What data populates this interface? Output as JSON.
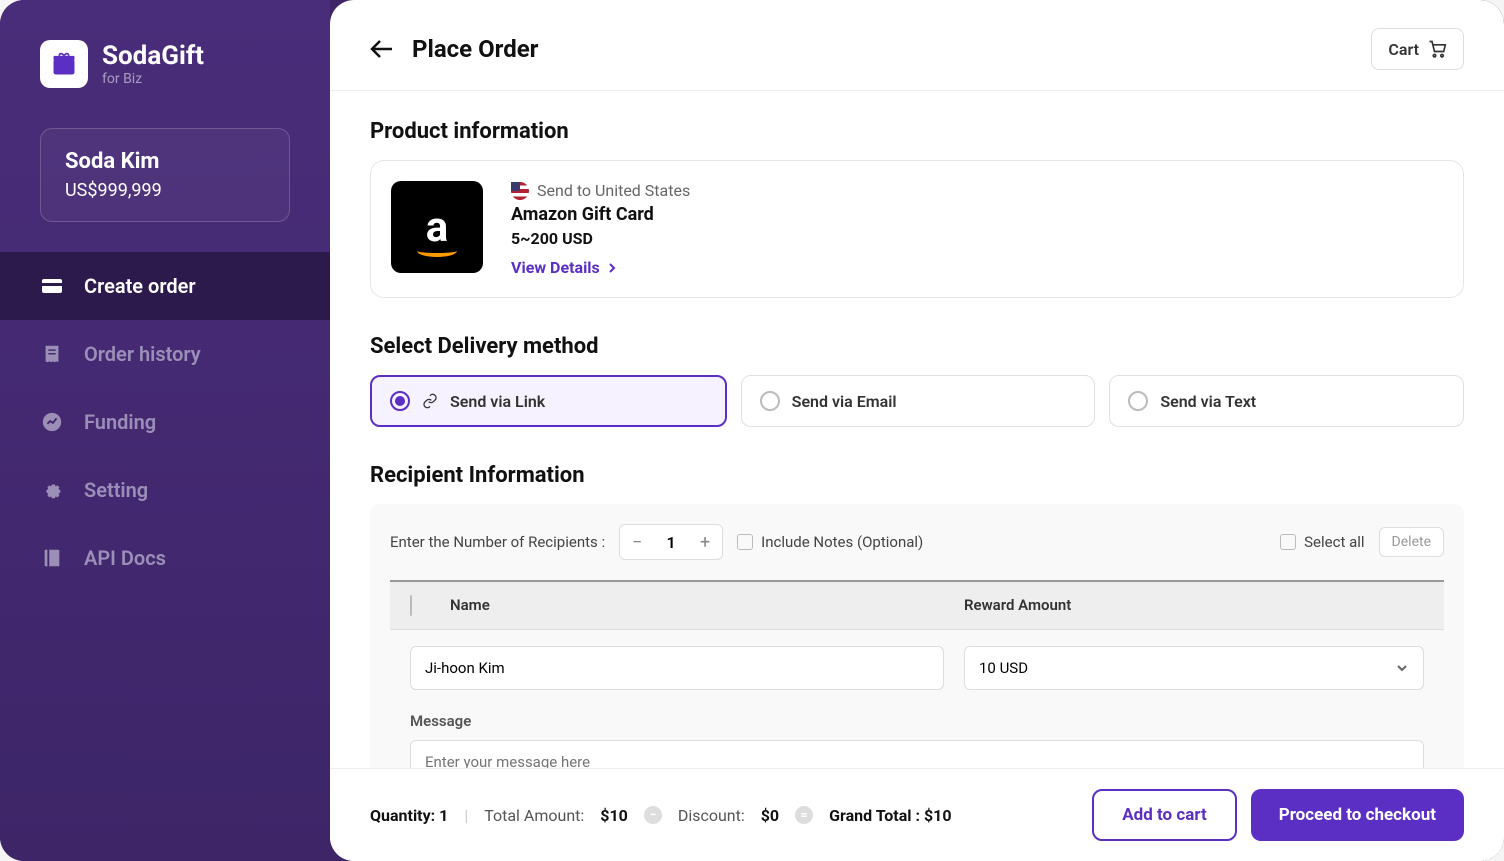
{
  "logo": {
    "name": "SodaGift",
    "sub": "for Biz"
  },
  "user": {
    "name": "Soda Kim",
    "balance": "US$999,999"
  },
  "nav": {
    "create_order": "Create order",
    "order_history": "Order history",
    "funding": "Funding",
    "setting": "Setting",
    "api_docs": "API Docs"
  },
  "header": {
    "title": "Place Order",
    "cart": "Cart"
  },
  "product": {
    "section_title": "Product information",
    "send_to": "Send to United States",
    "name": "Amazon Gift Card",
    "range": "5~200 USD",
    "view_details": "View Details"
  },
  "delivery": {
    "section_title": "Select Delivery method",
    "link": "Send via Link",
    "email": "Send via Email",
    "text": "Send via Text"
  },
  "recipient": {
    "section_title": "Recipient Information",
    "enter_label": "Enter the Number of Recipients :",
    "count": "1",
    "include_notes": "Include Notes (Optional)",
    "select_all": "Select all",
    "delete": "Delete",
    "col_name": "Name",
    "col_reward": "Reward Amount",
    "row_name_value": "Ji-hoon Kim",
    "row_reward_value": "10 USD",
    "message_label": "Message",
    "message_placeholder": "Enter your message here"
  },
  "footer": {
    "quantity_label": "Quantity:",
    "quantity_value": "1",
    "total_label": "Total Amount:",
    "total_value": "$10",
    "discount_label": "Discount:",
    "discount_value": "$0",
    "grand_label": "Grand Total :",
    "grand_value": "$10",
    "add_to_cart": "Add to cart",
    "checkout": "Proceed to checkout"
  }
}
